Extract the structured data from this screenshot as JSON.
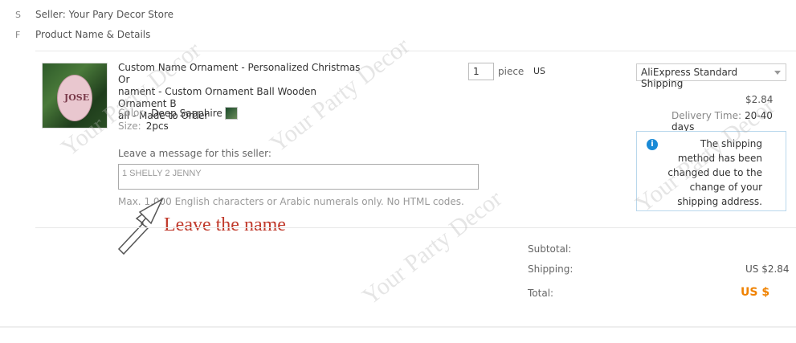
{
  "header": {
    "seller": "Seller: Your Pary Decor Store",
    "product_header": "Product Name & Details",
    "edge_chars": [
      "S",
      "F"
    ]
  },
  "item": {
    "thumbnail_text": "JOSE",
    "title_lines": [
      "Custom Name Ornament - Personalized Christmas Or",
      "nament - Custom Ornament Ball Wooden Ornament B",
      "all - Made to Order"
    ],
    "color_label": "Color:",
    "color_value": "Deep Sapphire",
    "size_label": "Size:",
    "size_value": "2pcs",
    "quantity": "1",
    "unit": "piece",
    "price": "US"
  },
  "message": {
    "label": "Leave a message for this seller:",
    "value": "1 SHELLY  2  JENNY",
    "hint": "Max. 1,000 English characters or Arabic numerals only. No HTML codes."
  },
  "annotation": "Leave the name",
  "shipping": {
    "method": "AliExpress Standard Shipping",
    "price": "$2.84",
    "delivery_label": "Delivery Time:",
    "delivery_value": "20-40 days",
    "notice": "The shipping method has been changed due to the change of your shipping address."
  },
  "summary": {
    "subtotal_label": "Subtotal:",
    "shipping_label": "Shipping:",
    "shipping_value": "US $2.84",
    "total_label": "Total:",
    "total_value": "US $"
  },
  "watermark": "Your Party Decor",
  "colors": {
    "accent": "#f08200",
    "info": "#1a8ad6",
    "annotation": "#c0392b"
  }
}
